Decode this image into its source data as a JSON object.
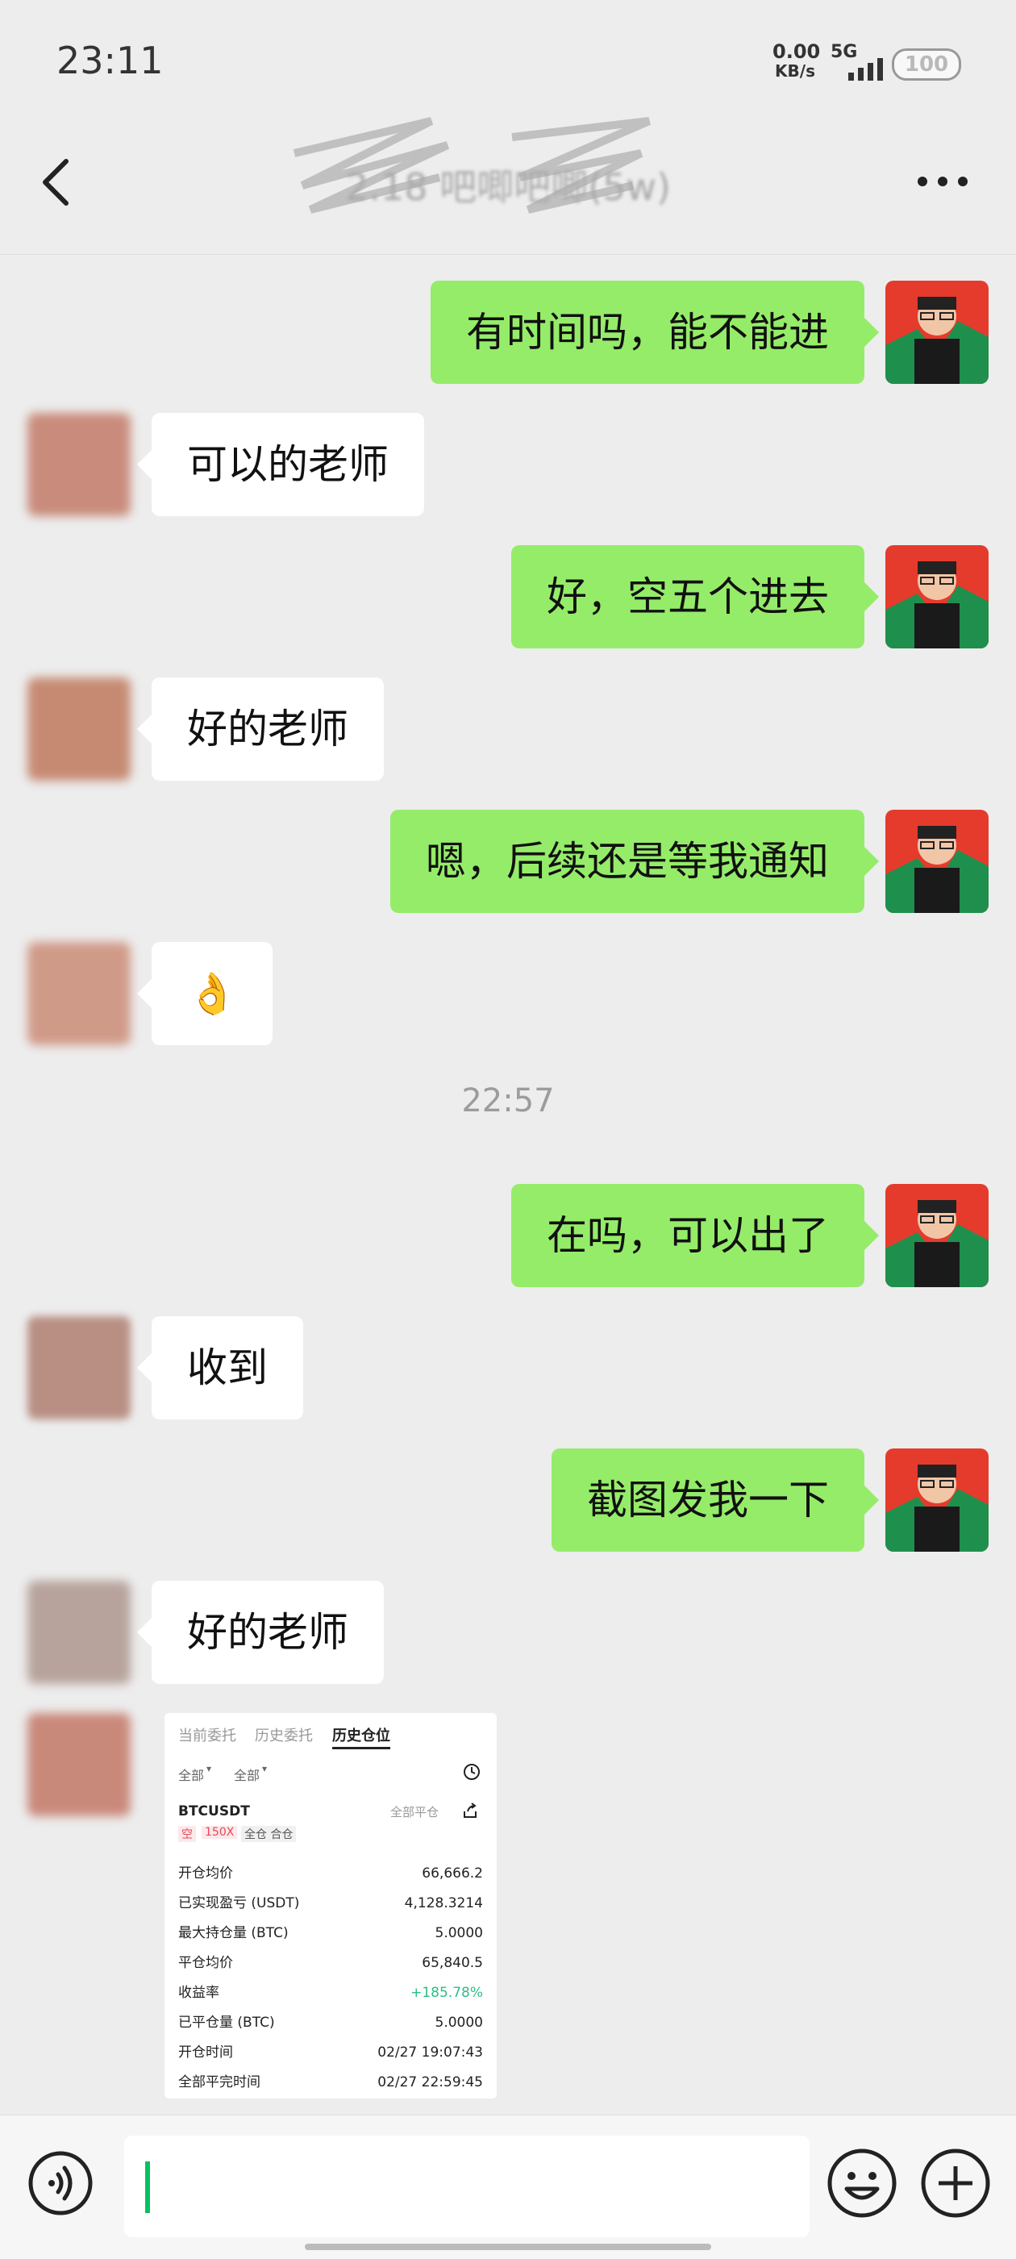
{
  "status_bar": {
    "time": "23:11",
    "net_speed_value": "0.00",
    "net_speed_unit": "KB/s",
    "network": "5G",
    "battery": "100"
  },
  "header": {
    "title": "2.18 吧唧吧唧(5w)",
    "back_icon": "chevron-left-icon",
    "more_icon": "more-dots-icon"
  },
  "messages": [
    {
      "side": "right",
      "text": "有时间吗，能不能进"
    },
    {
      "side": "left",
      "text": "可以的老师"
    },
    {
      "side": "right",
      "text": "好，空五个进去"
    },
    {
      "side": "left",
      "text": "好的老师"
    },
    {
      "side": "right",
      "text": "嗯，后续还是等我通知"
    },
    {
      "side": "left",
      "text": "👌",
      "kind": "emoji"
    },
    {
      "side": "right",
      "text": "在吗，可以出了"
    },
    {
      "side": "left",
      "text": "收到"
    },
    {
      "side": "right",
      "text": "截图发我一下"
    },
    {
      "side": "left",
      "text": "好的老师"
    }
  ],
  "timestamp": "22:57",
  "trade_card": {
    "tabs": [
      "当前委托",
      "历史委托",
      "历史仓位"
    ],
    "active_tab": "历史仓位",
    "filters": [
      "全部",
      "全部"
    ],
    "symbol": "BTCUSDT",
    "action": "全部平仓",
    "tags": [
      "空",
      "150X",
      "全仓 合仓"
    ],
    "rows": [
      {
        "label": "开仓均价",
        "value": "66,666.2"
      },
      {
        "label": "已实现盈亏 (USDT)",
        "value": "4,128.3214"
      },
      {
        "label": "最大持仓量 (BTC)",
        "value": "5.0000"
      },
      {
        "label": "平仓均价",
        "value": "65,840.5"
      },
      {
        "label": "收益率",
        "value": "+185.78%"
      },
      {
        "label": "已平仓量 (BTC)",
        "value": "5.0000"
      },
      {
        "label": "开仓时间",
        "value": "02/27 19:07:43"
      },
      {
        "label": "全部平完时间",
        "value": "02/27 22:59:45"
      }
    ],
    "positive_color": "#2ebd85"
  },
  "input_bar": {
    "voice_icon": "voice-icon",
    "emoji_icon": "emoji-icon",
    "add_icon": "plus-icon"
  },
  "colors": {
    "background": "#ededed",
    "my_bubble": "#95ec69",
    "other_bubble": "#ffffff",
    "accent": "#07c160"
  }
}
